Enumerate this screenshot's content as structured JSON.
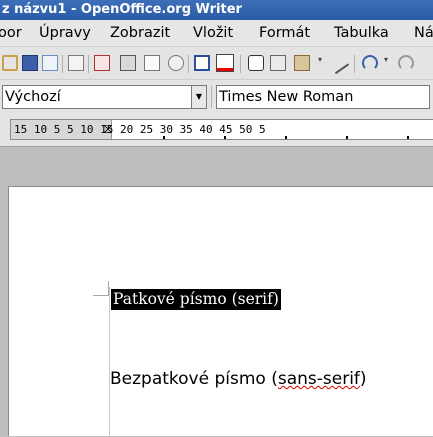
{
  "window": {
    "title": "z názvu1 - OpenOffice.org Writer"
  },
  "menu": {
    "items": [
      "oor",
      "Úpravy",
      "Zobrazit",
      "Vložit",
      "Formát",
      "Tabulka",
      "Ná"
    ]
  },
  "toolbar": {
    "icons": [
      "open-icon",
      "save-icon",
      "email-icon",
      "edit-file-icon",
      "export-pdf-icon",
      "print-icon",
      "page-preview-icon",
      "spellcheck-icon",
      "autospellcheck-icon",
      "cut-icon",
      "copy-icon",
      "paste-icon",
      "format-paintbrush-icon",
      "undo-icon"
    ]
  },
  "formatting": {
    "paragraph_style": "Výchozí",
    "font_name": "Times New Roman"
  },
  "ruler": {
    "text": "15  10   5       5   10  15  20  25  30  35  40  45  50  5"
  },
  "document": {
    "line1": "Patkové písmo (serif)",
    "line2_pre": "Bezpatkové písmo (",
    "line2_sq": "sans-serif",
    "line2_post": ")"
  },
  "colors": {
    "title_bar": "#2f5fae",
    "highlight": "#000000",
    "spell_underline": "#e00000"
  }
}
